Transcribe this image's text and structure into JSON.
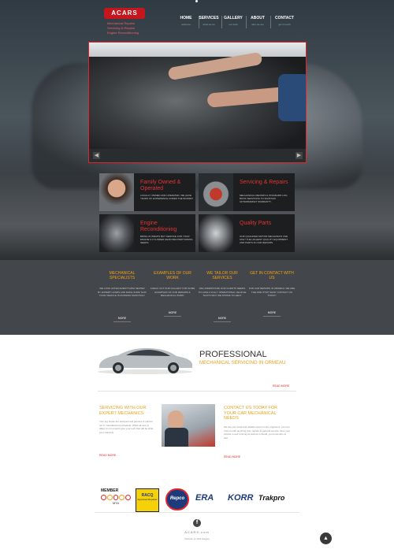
{
  "brand": {
    "logo_text": "ACARS",
    "line1": "Mechanical Repairs",
    "line2": "Servicing & Repairs",
    "line3": "Engine Reconditioning"
  },
  "nav": [
    {
      "label": "HOME",
      "sub": "welcome"
    },
    {
      "label": "SERVICES",
      "sub": "what we do"
    },
    {
      "label": "GALLERY",
      "sub": "our work"
    },
    {
      "label": "ABOUT",
      "sub": "who we are"
    },
    {
      "label": "CONTACT",
      "sub": "get in touch"
    }
  ],
  "slider": {
    "prev": "◀",
    "next": "▶"
  },
  "features": [
    {
      "title": "Family Owned & Operated",
      "text": "LOCALLY OWNED AND OPERATED. WE HAVE YEARS OF EXPERIENCE UNDER THE BONNET."
    },
    {
      "title": "Servicing & Repairs",
      "text": "MECHANICAL REPAIRS & STANDARD LOG BOOK SERVICING TO MAINTAIN AFTERMARKET WARRANTY."
    },
    {
      "title": "Engine Reconditioning",
      "text": "BRING IN WRAPS BUT SERVICE FOR YOUR ENGINE & CYLINDER HEAD RECONDITIONING NEEDS."
    },
    {
      "title": "Quality Parts",
      "text": "OUR QUALIFIED MOTOR MECHANICS USE ONLY THE HIGHEST QUALITY EQUIPMENT AND PARTS IN OUR REPAIRS."
    }
  ],
  "columns": [
    {
      "title": "MECHANICAL SPECIALISTS",
      "text": "WE LOOK AFTER EVERYTHING SEATED BY EXPERT HANDS AND MAKE SURE THAT YOUR VEHICLE IS RUNNING SMOOTHLY.",
      "more": "MORE"
    },
    {
      "title": "EXAMPLES OF OUR WORK",
      "text": "CHECK OUT OUR GALLERY FOR SOME EXAMPLES OF OUR REPAIRS & MECHANICAL WORK.",
      "more": "MORE"
    },
    {
      "title": "WE TAILOR OUR SERVICES",
      "text": "WE UNDERSTAND OUR CLIENTS NEEDS TO HAVE A FULLY OPERATIONAL VEHICLE THAT'S WHY WE STRIVE TO HELP.",
      "more": "MORE"
    },
    {
      "title": "GET IN CONTACT WITH US",
      "text": "FOR CAR REPAIRS IN ORMEAU, WE ARE THE ONE STOP SHOP. CONTACT US TODAY!",
      "more": "MORE"
    }
  ],
  "professional": {
    "title": "PROFESSIONAL",
    "subtitle": "MECHANICAL SERVICING IN ORMEAU",
    "read_more": "READ MORE"
  },
  "left_block": {
    "title": "SERVICING WITH OUR EXPERT MECHANICS",
    "text": "Your log books are stamped and genuine & carried out in manufacturers schedule. While all care is taken to our experts give your tech that will be what your warranty.",
    "read_more": "READ MORE"
  },
  "right_block": {
    "title": "CONTACT US TODAY FOR YOUR CAR MECHANICAL NEEDS",
    "text": "We are your local and reliable expert motor engineers; you can trust us with anything from repairs to general service. Give your vehicle in and running as well as it should, you know who to call.",
    "read_more": "READ MORE"
  },
  "sponsors": {
    "mta_top": "MEMBER",
    "mta_bottom": "MTA",
    "racq": "RACQ",
    "racq_sub": "Approved Repairer",
    "repco": "Repco",
    "era": "ERA",
    "korr": "KORR",
    "trakpro": "Trakpro"
  },
  "footer": {
    "fb": "f",
    "brand": "ACARS.com",
    "credit": "Website by Web Eagles",
    "top": "▲"
  }
}
